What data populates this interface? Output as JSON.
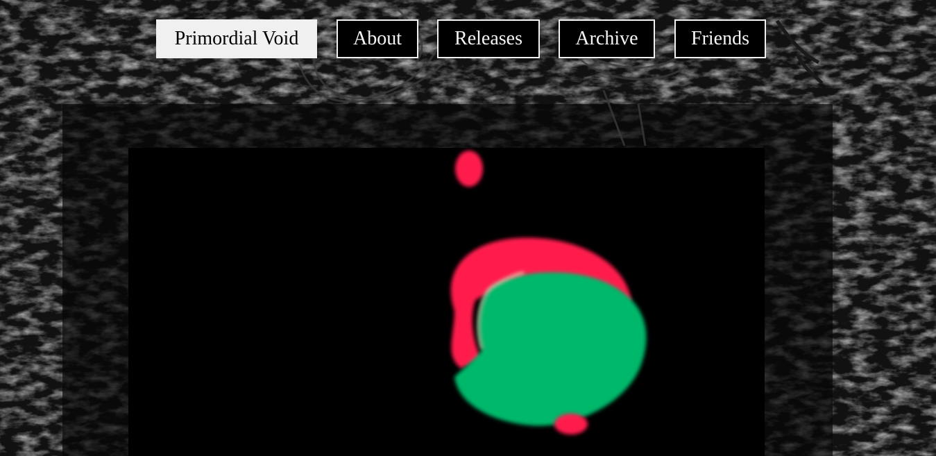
{
  "site": {
    "title": "Primordial Void"
  },
  "nav": {
    "items": [
      {
        "label": "Primordial Void",
        "active": true
      },
      {
        "label": "About",
        "active": false
      },
      {
        "label": "Releases",
        "active": false
      },
      {
        "label": "Archive",
        "active": false
      },
      {
        "label": "Friends",
        "active": false
      }
    ]
  },
  "colors": {
    "background": "#000000",
    "nav_border": "#f2f2f2",
    "active_bg": "#f0f0f0",
    "blob_red": "#ff1a4d",
    "blob_green": "#00b86b"
  }
}
